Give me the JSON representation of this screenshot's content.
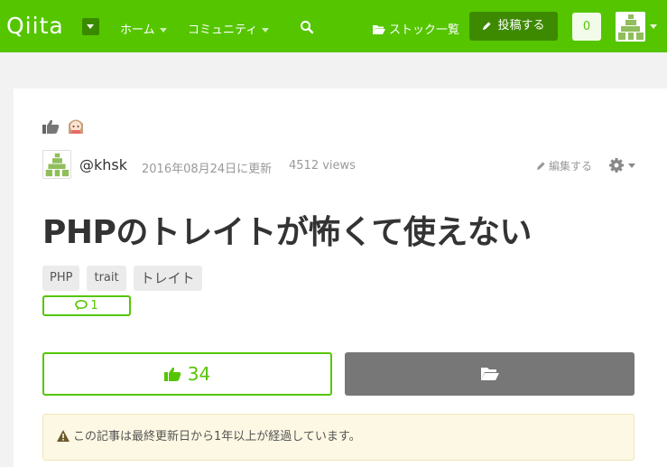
{
  "header": {
    "logo": "Qiita",
    "nav_home": "ホーム",
    "nav_community": "コミュニティ",
    "stock_label": "ストック一覧",
    "post_label": "投稿する",
    "notification_count": "0"
  },
  "article": {
    "author": "@khsk",
    "updated": "2016年08月24日に更新",
    "views": "4512 views",
    "edit_label": "編集する",
    "title": "PHPのトレイトが怖くて使えない",
    "tags": [
      "PHP",
      "trait",
      "トレイト"
    ],
    "comment_count": "1",
    "like_count": "34",
    "notice": "この記事は最終更新日から1年以上が経過しています。"
  },
  "colors": {
    "brand": "#55c500",
    "brand_dark": "#3d8a00",
    "stock_button": "#777777",
    "notice_bg": "#fcf8e3"
  },
  "icons": [
    "search-icon",
    "folder-open-icon",
    "pencil-icon",
    "thumbs-up-icon",
    "gear-icon",
    "comment-icon",
    "warning-icon"
  ]
}
